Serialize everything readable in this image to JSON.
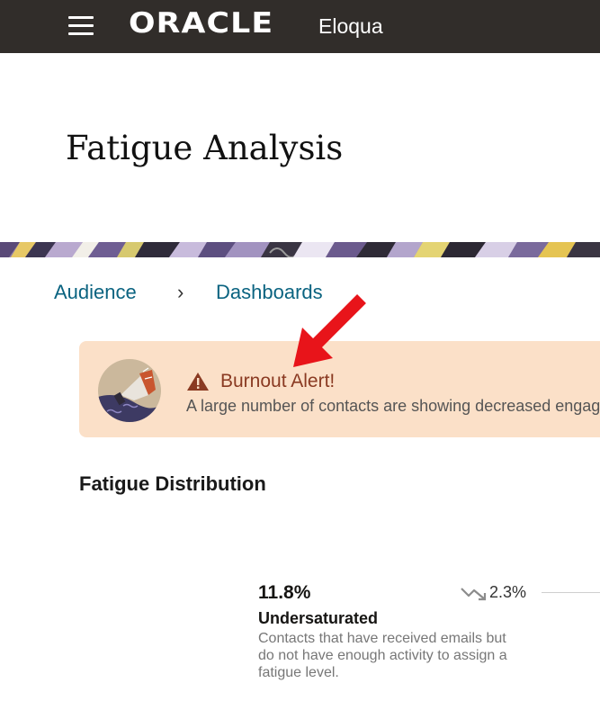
{
  "header": {
    "brand": "ORACLE",
    "product": "Eloqua",
    "menu_icon": "hamburger-menu-icon"
  },
  "page": {
    "title": "Fatigue Analysis"
  },
  "breadcrumb": {
    "items": [
      "Audience",
      "Dashboards"
    ],
    "separator": "›"
  },
  "alert": {
    "title": "Burnout Alert!",
    "message": "A large number of contacts are showing decreased engag",
    "icon": "warning-triangle-icon",
    "background": "#fbe0c8",
    "title_color": "#8a3a22"
  },
  "fatigue_distribution": {
    "title": "Fatigue Distribution",
    "stats": [
      {
        "percent": "11.8%",
        "label": "Undersaturated",
        "description": "Contacts that have received emails but do not have enough activity to assign a fatigue level.",
        "trend": "2.3%",
        "trend_icon": "trend-down-icon"
      }
    ]
  },
  "colors": {
    "header_bg": "#312d2a",
    "link": "#0a6380",
    "annotation_arrow": "#e8141a"
  }
}
